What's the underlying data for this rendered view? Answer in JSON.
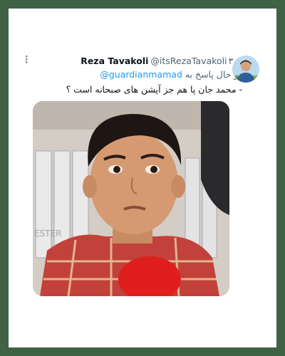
{
  "tweet": {
    "display_name": "Reza Tavakoli",
    "handle": "@itsRezaTavakoli",
    "time": "۳۰ر",
    "reply_prefix": "در حال پاسخ به",
    "reply_to": "@guardianmamad",
    "text": "- محمد جان پا هم جز آپشن های صبحانه است ؟"
  },
  "icons": {
    "more": "more-dots-icon",
    "avatar": "profile-avatar"
  },
  "media": {
    "type": "video-still",
    "description_icon": "child-photo"
  },
  "colors": {
    "frame": "#3f6146",
    "link": "#1d9bf0",
    "secondary_text": "#536471"
  }
}
